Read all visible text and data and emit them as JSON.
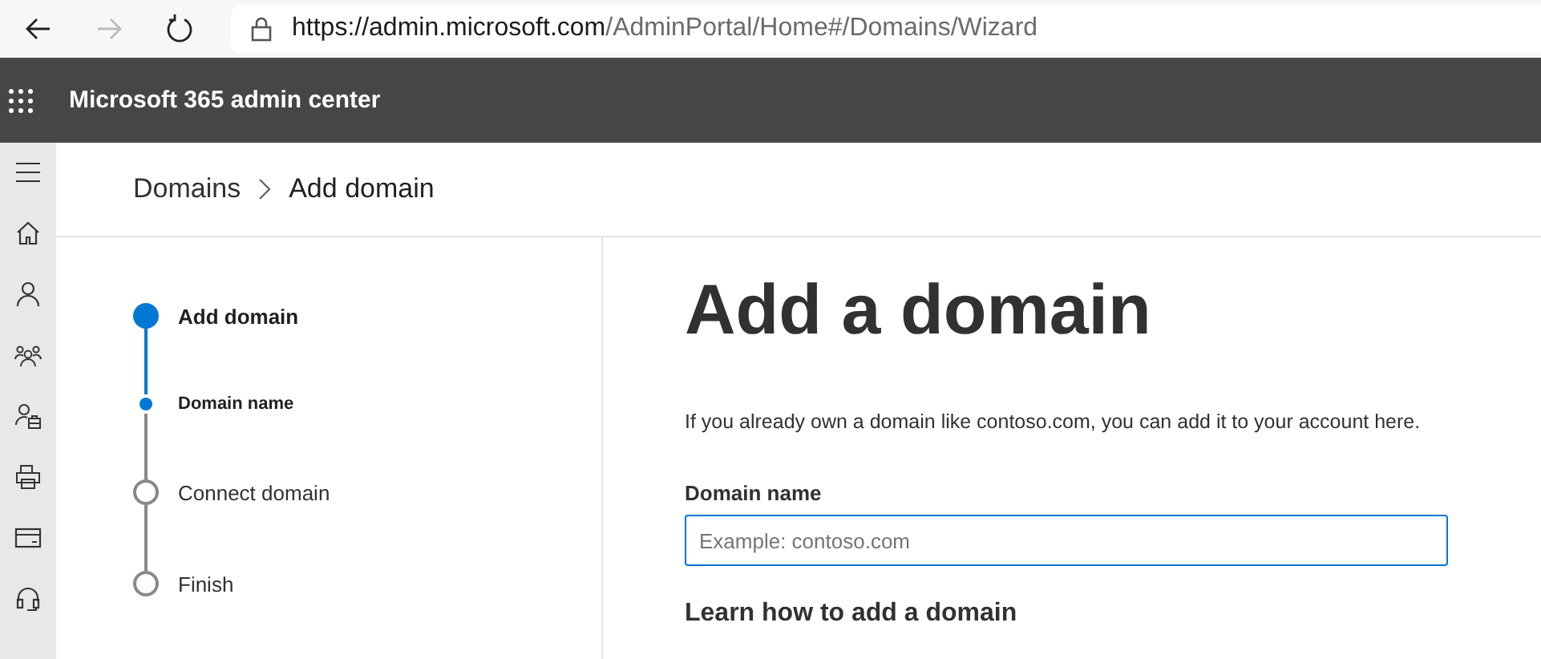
{
  "browser": {
    "url": {
      "host": "https://admin.microsoft.com",
      "path": "/AdminPortal/Home#/Domains/Wizard"
    }
  },
  "header": {
    "title": "Microsoft 365 admin center"
  },
  "breadcrumb": [
    {
      "label": "Domains",
      "selected": false
    },
    {
      "label": "Add domain",
      "selected": true
    }
  ],
  "steps": [
    {
      "label": "Add domain",
      "kind": "step",
      "current": true
    },
    {
      "label": "Domain name",
      "kind": "substep",
      "current": true
    },
    {
      "label": "Connect domain",
      "kind": "step",
      "current": false
    },
    {
      "label": "Finish",
      "kind": "step",
      "current": false
    }
  ],
  "content": {
    "title": "Add a domain",
    "description": "If you already own a domain like contoso.com, you can add it to your account here.",
    "field": {
      "label": "Domain name",
      "placeholder": "Example: contoso.com",
      "focused": true
    },
    "subheading": "Learn how to add a domain"
  }
}
